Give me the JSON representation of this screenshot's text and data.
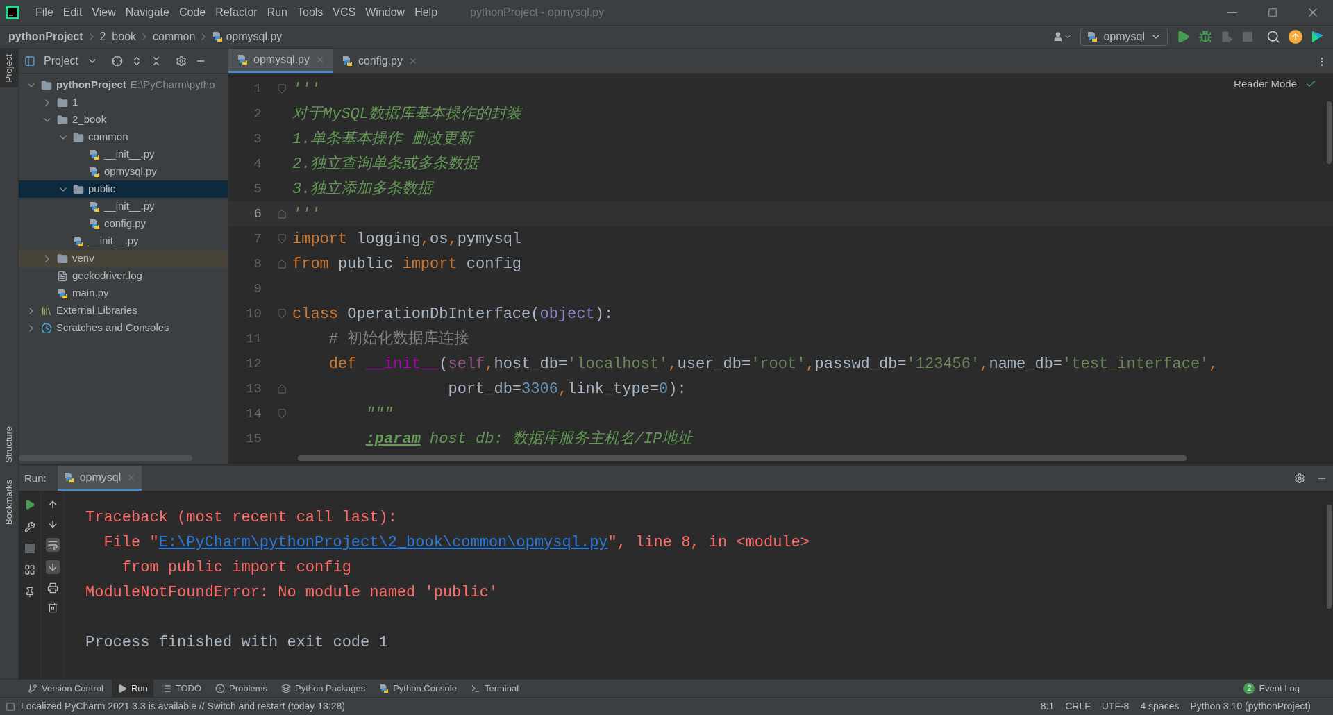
{
  "window": {
    "title": "pythonProject - opmysql.py"
  },
  "menu": [
    "File",
    "Edit",
    "View",
    "Navigate",
    "Code",
    "Refactor",
    "Run",
    "Tools",
    "VCS",
    "Window",
    "Help"
  ],
  "breadcrumbs": [
    {
      "text": "pythonProject",
      "kind": "project"
    },
    {
      "text": "2_book",
      "kind": "folder"
    },
    {
      "text": "common",
      "kind": "folder"
    },
    {
      "text": "opmysql.py",
      "kind": "python"
    }
  ],
  "run_config": {
    "label": "opmysql"
  },
  "left_stripe": [
    {
      "label": "Project",
      "selected": true
    },
    {
      "label": "Structure",
      "selected": false
    },
    {
      "label": "Bookmarks",
      "selected": false
    }
  ],
  "project_panel": {
    "title": "Project",
    "tree": [
      {
        "name": "pythonProject",
        "path": "E:\\PyCharm\\pytho",
        "kind": "folder",
        "expanded": true,
        "selected": false,
        "children": [
          {
            "name": "1",
            "kind": "folder",
            "expanded": false,
            "selected": false
          },
          {
            "name": "2_book",
            "kind": "package",
            "expanded": true,
            "selected": false,
            "children": [
              {
                "name": "common",
                "kind": "package",
                "expanded": true,
                "selected": false,
                "children": [
                  {
                    "name": "__init__.py",
                    "kind": "python",
                    "selected": false
                  },
                  {
                    "name": "opmysql.py",
                    "kind": "python",
                    "selected": false
                  }
                ]
              },
              {
                "name": "public",
                "kind": "package",
                "expanded": true,
                "selected": true,
                "children": [
                  {
                    "name": "__init__.py",
                    "kind": "python",
                    "selected": false
                  },
                  {
                    "name": "config.py",
                    "kind": "python",
                    "selected": false
                  }
                ]
              },
              {
                "name": "__init__.py",
                "kind": "python",
                "selected": false
              }
            ]
          },
          {
            "name": "venv",
            "kind": "excluded_folder",
            "expanded": false,
            "selected": false
          },
          {
            "name": "geckodriver.log",
            "kind": "log",
            "selected": false
          },
          {
            "name": "main.py",
            "kind": "python",
            "selected": false
          }
        ]
      },
      {
        "name": "External Libraries",
        "kind": "libraries",
        "expanded": false,
        "selected": false
      },
      {
        "name": "Scratches and Consoles",
        "kind": "scratches",
        "expanded": false,
        "selected": false
      }
    ]
  },
  "editor": {
    "tabs": [
      {
        "label": "opmysql.py",
        "selected": true
      },
      {
        "label": "config.py",
        "selected": false
      }
    ],
    "reader_mode": "Reader Mode",
    "lines": [
      {
        "number": "1",
        "current": false,
        "kind": "fold_start",
        "segments": [
          {
            "kind": "docstring",
            "text": "'''"
          }
        ]
      },
      {
        "number": "2",
        "current": false,
        "kind": "code",
        "segments": [
          {
            "kind": "docstring",
            "text": "对于MySQL数据库基本操作的封装"
          }
        ]
      },
      {
        "number": "3",
        "current": false,
        "kind": "code",
        "segments": [
          {
            "kind": "docstring",
            "text": "1.单条基本操作 删改更新"
          }
        ]
      },
      {
        "number": "4",
        "current": false,
        "kind": "code",
        "segments": [
          {
            "kind": "docstring",
            "text": "2.独立查询单条或多条数据"
          }
        ]
      },
      {
        "number": "5",
        "current": false,
        "kind": "code",
        "segments": [
          {
            "kind": "docstring",
            "text": "3.独立添加多条数据"
          }
        ]
      },
      {
        "number": "6",
        "current": true,
        "kind": "fold_end",
        "segments": [
          {
            "kind": "docstring",
            "text": "'''"
          }
        ]
      },
      {
        "number": "7",
        "current": false,
        "kind": "fold_start",
        "segments": [
          {
            "kind": "keyword",
            "text": "import"
          },
          {
            "kind": "plain",
            "text": " logging"
          },
          {
            "kind": "keyword",
            "text": ","
          },
          {
            "kind": "plain",
            "text": "os"
          },
          {
            "kind": "keyword",
            "text": ","
          },
          {
            "kind": "plain",
            "text": "pymysql"
          }
        ]
      },
      {
        "number": "8",
        "current": false,
        "kind": "fold_end",
        "segments": [
          {
            "kind": "keyword",
            "text": "from"
          },
          {
            "kind": "plain",
            "text": " public "
          },
          {
            "kind": "keyword",
            "text": "import"
          },
          {
            "kind": "plain",
            "text": " config"
          }
        ]
      },
      {
        "number": "9",
        "current": false,
        "kind": "code"
      },
      {
        "number": "10",
        "current": false,
        "kind": "fold_start",
        "segments": [
          {
            "kind": "keyword",
            "text": "class"
          },
          {
            "kind": "plain",
            "text": " OperationDbInterface("
          },
          {
            "kind": "builtin",
            "text": "object"
          },
          {
            "kind": "plain",
            "text": "):"
          }
        ]
      },
      {
        "number": "11",
        "current": false,
        "kind": "code",
        "segments": [
          {
            "kind": "comment",
            "text": "    # 初始化数据库连接"
          }
        ]
      },
      {
        "number": "12",
        "current": false,
        "kind": "code",
        "segments": [
          {
            "kind": "keyword",
            "text": "    def "
          },
          {
            "kind": "magic",
            "text": "__init__"
          },
          {
            "kind": "plain",
            "text": "("
          },
          {
            "kind": "self",
            "text": "self"
          },
          {
            "kind": "keyword",
            "text": ","
          },
          {
            "kind": "plain",
            "text": "host_db="
          },
          {
            "kind": "string",
            "text": "'localhost'"
          },
          {
            "kind": "keyword",
            "text": ","
          },
          {
            "kind": "plain",
            "text": "user_db="
          },
          {
            "kind": "string",
            "text": "'root'"
          },
          {
            "kind": "keyword",
            "text": ","
          },
          {
            "kind": "plain",
            "text": "passwd_db="
          },
          {
            "kind": "string",
            "text": "'123456'"
          },
          {
            "kind": "keyword",
            "text": ","
          },
          {
            "kind": "plain",
            "text": "name_db="
          },
          {
            "kind": "string",
            "text": "'test_interface'"
          },
          {
            "kind": "keyword",
            "text": ","
          }
        ]
      },
      {
        "number": "13",
        "current": false,
        "kind": "fold_end",
        "segments": [
          {
            "kind": "plain",
            "text": "                 port_db="
          },
          {
            "kind": "number",
            "text": "3306"
          },
          {
            "kind": "keyword",
            "text": ","
          },
          {
            "kind": "plain",
            "text": "link_type="
          },
          {
            "kind": "number",
            "text": "0"
          },
          {
            "kind": "plain",
            "text": "):"
          }
        ]
      },
      {
        "number": "14",
        "current": false,
        "kind": "fold_start",
        "segments": [
          {
            "kind": "docstring",
            "text": "        \"\"\""
          }
        ]
      },
      {
        "number": "15",
        "current": false,
        "kind": "code",
        "segments": [
          {
            "kind": "param",
            "text": "        :param"
          },
          {
            "kind": "docstring",
            "text": " host_db: 数据库服务主机名/IP地址"
          }
        ]
      }
    ]
  },
  "run_panel": {
    "label": "Run:",
    "tab": "opmysql",
    "output": [
      [
        {
          "kind": "error",
          "text": "Traceback (most recent call last):"
        }
      ],
      [
        {
          "kind": "error",
          "text": "  File \""
        },
        {
          "kind": "link",
          "text": "E:\\PyCharm\\pythonProject\\2_book\\common\\opmysql.py"
        },
        {
          "kind": "error",
          "text": "\", line 8, in <module>"
        }
      ],
      [
        {
          "kind": "error",
          "text": "    from public import config"
        }
      ],
      [
        {
          "kind": "error",
          "text": "ModuleNotFoundError: No module named 'public'"
        }
      ]
    ],
    "exit_message": "Process finished with exit code 1"
  },
  "tool_windows": [
    {
      "label": "Version Control",
      "kind": "vcs",
      "selected": false
    },
    {
      "label": "Run",
      "kind": "run",
      "selected": true
    },
    {
      "label": "TODO",
      "kind": "todo",
      "selected": false
    },
    {
      "label": "Problems",
      "kind": "problems",
      "selected": false
    },
    {
      "label": "Python Packages",
      "kind": "packages",
      "selected": false
    },
    {
      "label": "Python Console",
      "kind": "console",
      "selected": false
    },
    {
      "label": "Terminal",
      "kind": "terminal",
      "selected": false
    }
  ],
  "event_log": {
    "label": "Event Log",
    "count": "2"
  },
  "status_bar": {
    "message": "Localized PyCharm 2021.3.3 is available // Switch and restart (today 13:28)",
    "items": [
      "8:1",
      "CRLF",
      "UTF-8",
      "4 spaces",
      "Python 3.10 (pythonProject)"
    ]
  }
}
